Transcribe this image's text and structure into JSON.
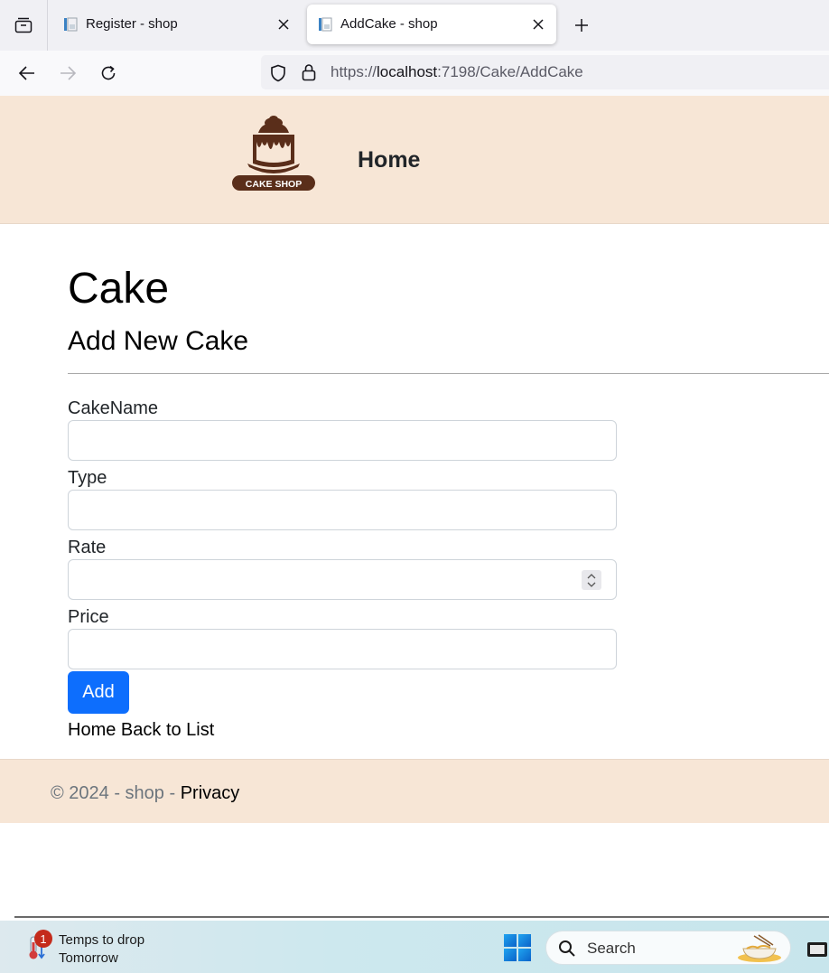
{
  "browser": {
    "tabs": [
      {
        "title": "Register - shop",
        "active": false
      },
      {
        "title": "AddCake - shop",
        "active": true
      }
    ],
    "url": {
      "scheme": "https://",
      "host": "localhost",
      "rest": ":7198/Cake/AddCake"
    }
  },
  "site": {
    "logo_text": "CAKE SHOP",
    "nav_home": "Home"
  },
  "page": {
    "title": "Cake",
    "subtitle": "Add New Cake",
    "fields": [
      {
        "label": "CakeName",
        "value": ""
      },
      {
        "label": "Type",
        "value": ""
      },
      {
        "label": "Rate",
        "value": ""
      },
      {
        "label": "Price",
        "value": ""
      }
    ],
    "submit_label": "Add",
    "link_home": "Home",
    "link_back": "Back to List"
  },
  "footer": {
    "copyright": "© 2024 - shop - ",
    "privacy": "Privacy"
  },
  "taskbar": {
    "weather_badge": "1",
    "weather_line1": "Temps to drop",
    "weather_line2": "Tomorrow",
    "search_placeholder": "Search"
  },
  "colors": {
    "header_bg": "#f7e6d6",
    "primary": "#0d6efd",
    "brown": "#5a2e1a"
  }
}
